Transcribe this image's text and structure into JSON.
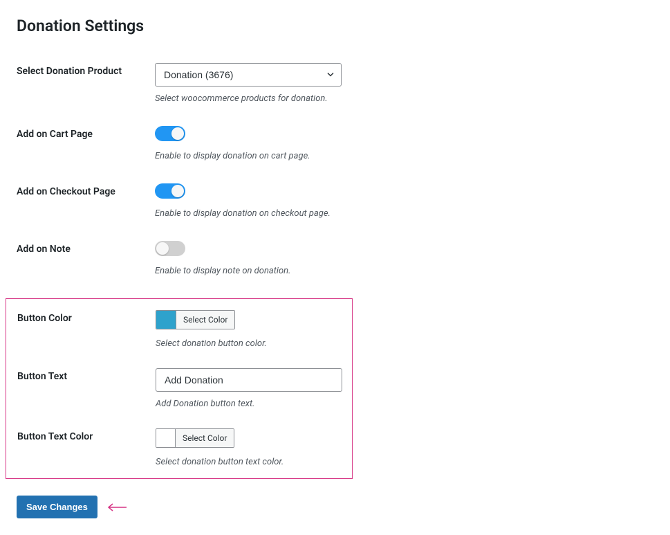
{
  "page_title": "Donation Settings",
  "fields": {
    "select_product": {
      "label": "Select Donation Product",
      "value": "Donation (3676)",
      "description": "Select woocommerce products for donation."
    },
    "add_cart": {
      "label": "Add on Cart Page",
      "description": "Enable to display donation on cart page."
    },
    "add_checkout": {
      "label": "Add on Checkout Page",
      "description": "Enable to display donation on checkout page."
    },
    "add_note": {
      "label": "Add on Note",
      "description": "Enable to display note on donation."
    },
    "button_color": {
      "label": "Button Color",
      "select_label": "Select Color",
      "value": "#2ea2cc",
      "description": "Select donation button color."
    },
    "button_text": {
      "label": "Button Text",
      "value": "Add Donation",
      "description": "Add Donation button text."
    },
    "button_text_color": {
      "label": "Button Text Color",
      "select_label": "Select Color",
      "value": "#ffffff",
      "description": "Select donation button text color."
    }
  },
  "save_label": "Save Changes"
}
